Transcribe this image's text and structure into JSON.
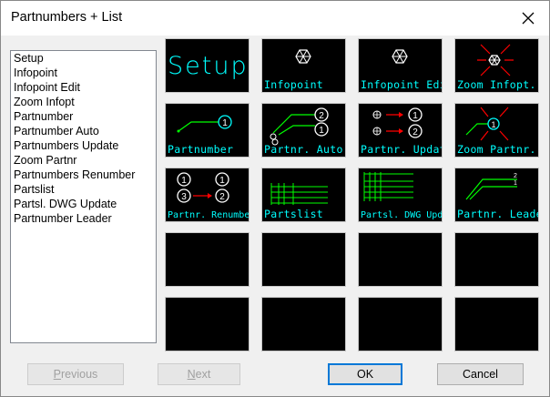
{
  "window": {
    "title": "Partnumbers + List"
  },
  "list": {
    "items": [
      "Setup",
      "Infopoint",
      "Infopoint Edit",
      "Zoom Infopt",
      "Partnumber",
      "Partnumber Auto",
      "Partnumbers Update",
      "Zoom Partnr",
      "Partnumbers Renumber",
      "Partslist",
      "Partsl. DWG Update",
      "Partnumber Leader"
    ]
  },
  "tiles": [
    {
      "label": "Setup"
    },
    {
      "label": "Infopoint"
    },
    {
      "label": "Infopoint Edit"
    },
    {
      "label": "Zoom Infopt."
    },
    {
      "label": "Partnumber"
    },
    {
      "label": "Partnr. Auto"
    },
    {
      "label": "Partnr. Update"
    },
    {
      "label": "Zoom Partnr."
    },
    {
      "label": "Partnr. Renumber"
    },
    {
      "label": "Partslist"
    },
    {
      "label": "Partsl. DWG Update"
    },
    {
      "label": "Partnr. Leader"
    }
  ],
  "buttons": {
    "previous_first": "P",
    "previous_rest": "revious",
    "next_first": "N",
    "next_rest": "ext",
    "ok": "OK",
    "cancel": "Cancel"
  },
  "colors": {
    "tile_bg": "#000000",
    "tile_text": "#00ffff",
    "line_green": "#00ff00",
    "arrow_red": "#ff0000",
    "circle_cyan": "#00ffff"
  }
}
